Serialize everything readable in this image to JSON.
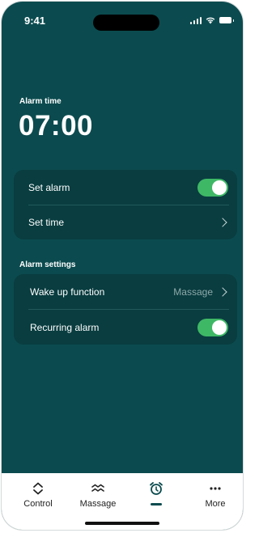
{
  "status_bar": {
    "time": "9:41"
  },
  "alarm": {
    "label": "Alarm time",
    "time": "07:00"
  },
  "card_alarm": {
    "set_alarm_label": "Set alarm",
    "set_alarm_on": true,
    "set_time_label": "Set time"
  },
  "settings": {
    "title": "Alarm settings",
    "wake_up_label": "Wake up function",
    "wake_up_value": "Massage",
    "recurring_label": "Recurring alarm",
    "recurring_on": true
  },
  "tabs": [
    {
      "label": "Control",
      "icon": "control-icon"
    },
    {
      "label": "Massage",
      "icon": "waves-icon"
    },
    {
      "label": "",
      "icon": "alarm-clock-icon",
      "active": true
    },
    {
      "label": "More",
      "icon": "more-icon"
    }
  ],
  "colors": {
    "background": "#0b4b4f",
    "card": "#093d40",
    "toggle_on": "#3fb866",
    "tab_bar": "#ffffff"
  }
}
